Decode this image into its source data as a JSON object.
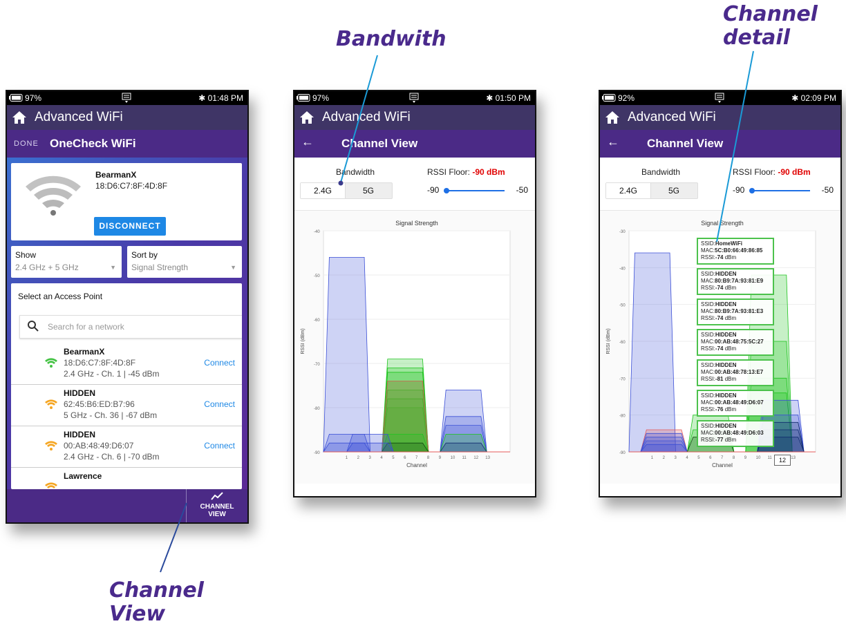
{
  "callouts": {
    "bandwidth": "Bandwith",
    "channel_detail_1": "Channel",
    "channel_detail_2": "detail",
    "channel_view_1": "Channel",
    "channel_view_2": "View"
  },
  "screen1": {
    "status": {
      "battery": "97%",
      "time": "01:48 PM"
    },
    "app_title": "Advanced WiFi",
    "done_label": "DONE",
    "subtitle": "OneCheck WiFi",
    "connected": {
      "name": "BearmanX",
      "mac": "18:D6:C7:8F:4D:8F",
      "button": "DISCONNECT"
    },
    "show": {
      "label": "Show",
      "value": "2.4 GHz + 5 GHz"
    },
    "sort": {
      "label": "Sort by",
      "value": "Signal Strength"
    },
    "access_points": {
      "title": "Select an Access Point",
      "search_placeholder": "Search for a network",
      "items": [
        {
          "name": "BearmanX",
          "mac": "18:D6:C7:8F:4D:8F",
          "info": "2.4 GHz - Ch. 1 | -45 dBm",
          "action": "Connect",
          "color": "#43c243"
        },
        {
          "name": "HIDDEN",
          "mac": "62:45:B6:ED:B7:96",
          "info": "5 GHz - Ch. 36 | -67 dBm",
          "action": "Connect",
          "color": "#f5a623"
        },
        {
          "name": "HIDDEN",
          "mac": "00:AB:48:49:D6:07",
          "info": "2.4 GHz - Ch. 6 | -70 dBm",
          "action": "Connect",
          "color": "#f5a623"
        },
        {
          "name": "Lawrence",
          "mac": "",
          "info": "",
          "action": "",
          "color": "#f5a623"
        }
      ]
    },
    "channel_view_button": {
      "line1": "CHANNEL",
      "line2": "VIEW"
    }
  },
  "screen2": {
    "status": {
      "battery": "97%",
      "time": "01:50 PM"
    },
    "app_title": "Advanced WiFi",
    "subtitle": "Channel View",
    "bandwidth_label": "Bandwidth",
    "band_options": [
      "2.4G",
      "5G"
    ],
    "rssi_floor_label": "RSSI Floor:",
    "rssi_floor_value": "-90 dBm",
    "slider": {
      "min": "-90",
      "max": "-50"
    }
  },
  "screen3": {
    "status": {
      "battery": "92%",
      "time": "02:09 PM"
    },
    "app_title": "Advanced WiFi",
    "subtitle": "Channel View",
    "bandwidth_label": "Bandwidth",
    "band_options": [
      "2.4G",
      "5G"
    ],
    "rssi_floor_label": "RSSI Floor:",
    "rssi_floor_value": "-90 dBm",
    "slider": {
      "min": "-90",
      "max": "-50"
    },
    "tooltips": [
      {
        "ssid": "HomeWiFi",
        "mac": "5C:B0:66:49:86:85",
        "rssi": "-74"
      },
      {
        "ssid": "HIDDEN",
        "mac": "80:B9:7A:93:81:E9",
        "rssi": "-74"
      },
      {
        "ssid": "HIDDEN",
        "mac": "80:B9:7A:93:81:E3",
        "rssi": "-74"
      },
      {
        "ssid": "HIDDEN",
        "mac": "00:AB:48:75:5C:27",
        "rssi": "-74"
      },
      {
        "ssid": "HIDDEN",
        "mac": "00:AB:48:78:13:E7",
        "rssi": "-81"
      },
      {
        "ssid": "HIDDEN",
        "mac": "00:AB:48:49:D6:07",
        "rssi": "-76"
      },
      {
        "ssid": "HIDDEN",
        "mac": "00:AB:48:49:D6:03",
        "rssi": "-77"
      }
    ],
    "tooltip_labels": {
      "ssid": "SSID:",
      "mac": "MAC:",
      "rssi": "RSSI:",
      "unit": " dBm"
    },
    "channel_tip": "12"
  },
  "chart_data": [
    {
      "type": "area",
      "title": "Signal Strength",
      "xlabel": "Channel",
      "ylabel": "RSSI (dBm)",
      "x_ticks": [
        1,
        2,
        3,
        4,
        5,
        6,
        7,
        8,
        9,
        10,
        11,
        12,
        13
      ],
      "xlim": [
        -1,
        15
      ],
      "ylim": [
        -90,
        -40
      ],
      "y_ticks": [
        -40,
        -50,
        -60,
        -70,
        -80,
        -90
      ],
      "rssi_floor": -90,
      "series": [
        {
          "channel": 1,
          "rssi": -46,
          "color": "#3b4fd6"
        },
        {
          "channel": 1,
          "rssi": -86,
          "color": "#3b4fd6"
        },
        {
          "channel": 1,
          "rssi": -88,
          "color": "#3b4fd6"
        },
        {
          "channel": 6,
          "rssi": -69,
          "color": "#1ec41e"
        },
        {
          "channel": 6,
          "rssi": -71,
          "color": "#1ec41e"
        },
        {
          "channel": 6,
          "rssi": -72,
          "color": "#1ec41e"
        },
        {
          "channel": 6,
          "rssi": -74,
          "color": "#1ec41e"
        },
        {
          "channel": 6,
          "rssi": -76,
          "color": "#1ec41e"
        },
        {
          "channel": 6,
          "rssi": -78,
          "color": "#1ec41e"
        },
        {
          "channel": 6,
          "rssi": -80,
          "color": "#1ec41e"
        },
        {
          "channel": 6,
          "rssi": -74,
          "color": "#e45a5a"
        },
        {
          "channel": 6,
          "rssi": -86,
          "color": "#1ec41e"
        },
        {
          "channel": 6,
          "rssi": -88,
          "color": "#0e4a0e"
        },
        {
          "channel": 11,
          "rssi": -76,
          "color": "#3b4fd6"
        },
        {
          "channel": 11,
          "rssi": -82,
          "color": "#3b4fd6"
        },
        {
          "channel": 11,
          "rssi": -84,
          "color": "#3b4fd6"
        },
        {
          "channel": 11,
          "rssi": -86,
          "color": "#1ec41e"
        },
        {
          "channel": 11,
          "rssi": -88,
          "color": "#0e2a6e"
        },
        {
          "channel": 3,
          "rssi": -86,
          "color": "#3b4fd6"
        },
        {
          "channel": 3,
          "rssi": -88,
          "color": "#3b4fd6"
        }
      ]
    },
    {
      "type": "area",
      "title": "Signal Strength",
      "xlabel": "Channel",
      "ylabel": "RSSI (dBm)",
      "x_ticks": [
        1,
        2,
        3,
        4,
        5,
        6,
        7,
        8,
        9,
        10,
        11,
        12,
        13
      ],
      "xlim": [
        -1,
        15
      ],
      "ylim": [
        -90,
        -30
      ],
      "y_ticks": [
        -30,
        -40,
        -50,
        -60,
        -70,
        -80,
        -90
      ],
      "rssi_floor": -90,
      "series": [
        {
          "channel": 1,
          "rssi": -36,
          "color": "#3b4fd6"
        },
        {
          "channel": 2,
          "rssi": -84,
          "color": "#e45a5a"
        },
        {
          "channel": 2,
          "rssi": -85,
          "color": "#3b4fd6"
        },
        {
          "channel": 2,
          "rssi": -86,
          "color": "#3b4fd6"
        },
        {
          "channel": 2,
          "rssi": -87,
          "color": "#3b4fd6"
        },
        {
          "channel": 2,
          "rssi": -88,
          "color": "#3b4fd6"
        },
        {
          "channel": 6,
          "rssi": -80,
          "color": "#1ec41e"
        },
        {
          "channel": 6,
          "rssi": -84,
          "color": "#1ec41e"
        },
        {
          "channel": 6,
          "rssi": -86,
          "color": "#0e4a0e"
        },
        {
          "channel": 11,
          "rssi": -42,
          "color": "#1ec41e"
        },
        {
          "channel": 11,
          "rssi": -60,
          "color": "#1ec41e"
        },
        {
          "channel": 11,
          "rssi": -70,
          "color": "#1ec41e"
        },
        {
          "channel": 11,
          "rssi": -74,
          "color": "#1ec41e"
        },
        {
          "channel": 12,
          "rssi": -76,
          "color": "#3b4fd6"
        },
        {
          "channel": 12,
          "rssi": -80,
          "color": "#3b4fd6"
        },
        {
          "channel": 12,
          "rssi": -82,
          "color": "#0e2a6e"
        },
        {
          "channel": 12,
          "rssi": -84,
          "color": "#0e2a6e"
        },
        {
          "channel": 12,
          "rssi": -86,
          "color": "#0e2a6e"
        }
      ]
    }
  ]
}
